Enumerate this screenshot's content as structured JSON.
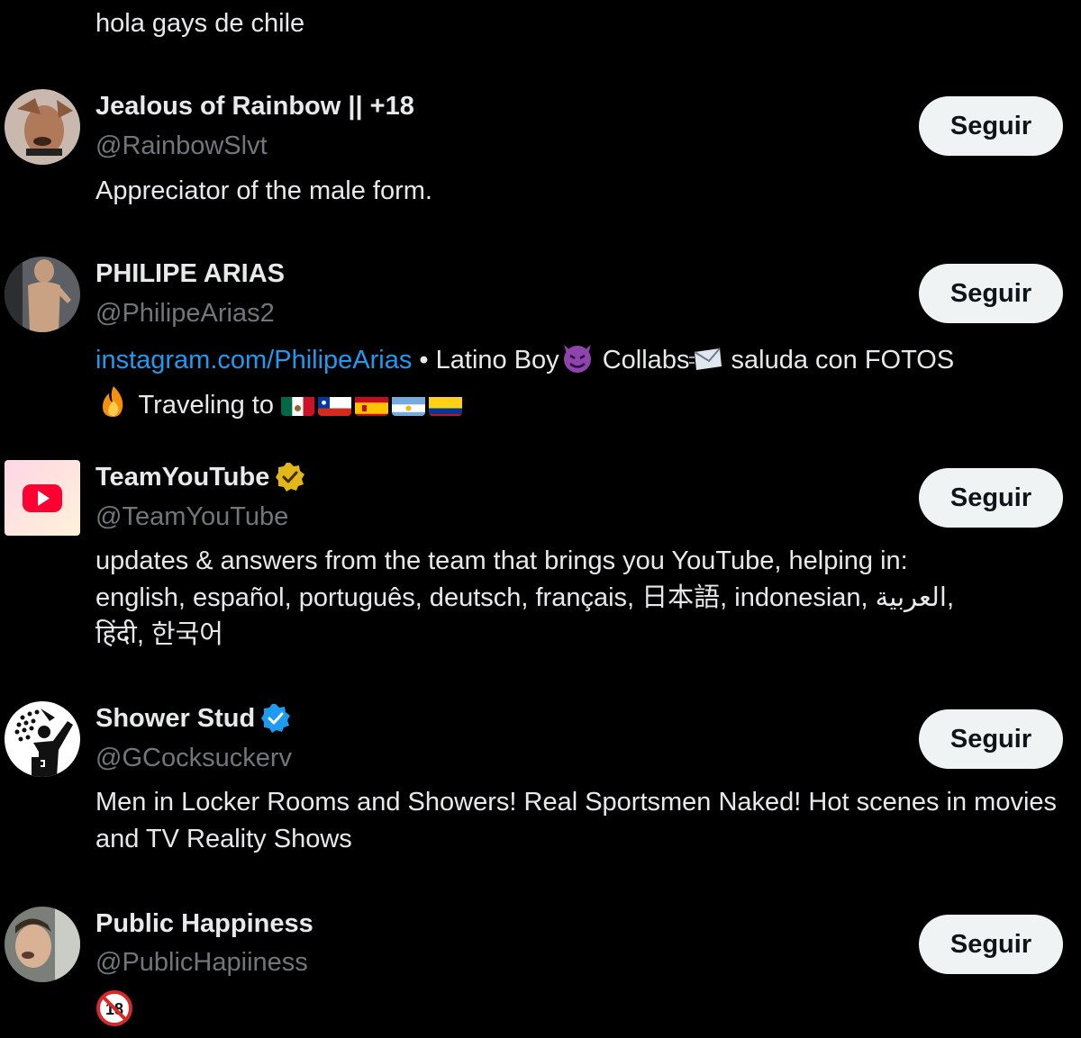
{
  "top_bio": "hola gays de chile",
  "follow_label": "Seguir",
  "users": [
    {
      "name": "Jealous of Rainbow || +18",
      "handle": "@RainbowSlvt",
      "bio": "Appreciator of the male form."
    },
    {
      "name": "PHILIPE ARIAS",
      "handle": "@PhilipeArias2",
      "bio_link": "instagram.com/PhilipeArias",
      "bio_text_1": " • Latino Boy",
      "bio_text_2": " Collabs",
      "bio_text_3": " saluda con FOTOS",
      "bio_text_4": " Traveling to",
      "emojis": [
        "smiling-devil-icon",
        "envelope-icon",
        "fire-icon"
      ],
      "flags": [
        "mexico-flag-icon",
        "chile-flag-icon",
        "spain-flag-icon",
        "argentina-flag-icon",
        "colombia-flag-icon"
      ]
    },
    {
      "name": "TeamYouTube",
      "handle": "@TeamYouTube",
      "verified": "gold",
      "bio_line_1": "updates & answers from the team that brings you YouTube, helping in:",
      "bio_line_2": "english, español, português, deutsch, français, 日本語, indonesian, العربية,",
      "bio_line_3": "हिंदी, 한국어"
    },
    {
      "name": "Shower Stud",
      "handle": "@GCocksuckerv",
      "verified": "blue",
      "bio": "Men in Locker Rooms and Showers! Real Sportsmen Naked! Hot scenes in movies and TV Reality Shows"
    },
    {
      "name": "Public Happiness",
      "handle": "@PublicHapiiness",
      "bio_icon": "no-under-18-icon"
    }
  ],
  "colors": {
    "background": "#000000",
    "text": "#e7e9ea",
    "muted": "#71767b",
    "link": "#1d9bf0",
    "button_bg": "#eff3f4",
    "button_text": "#0f1419",
    "verified_blue": "#1d9bf0",
    "verified_gold": "#e2b719"
  }
}
